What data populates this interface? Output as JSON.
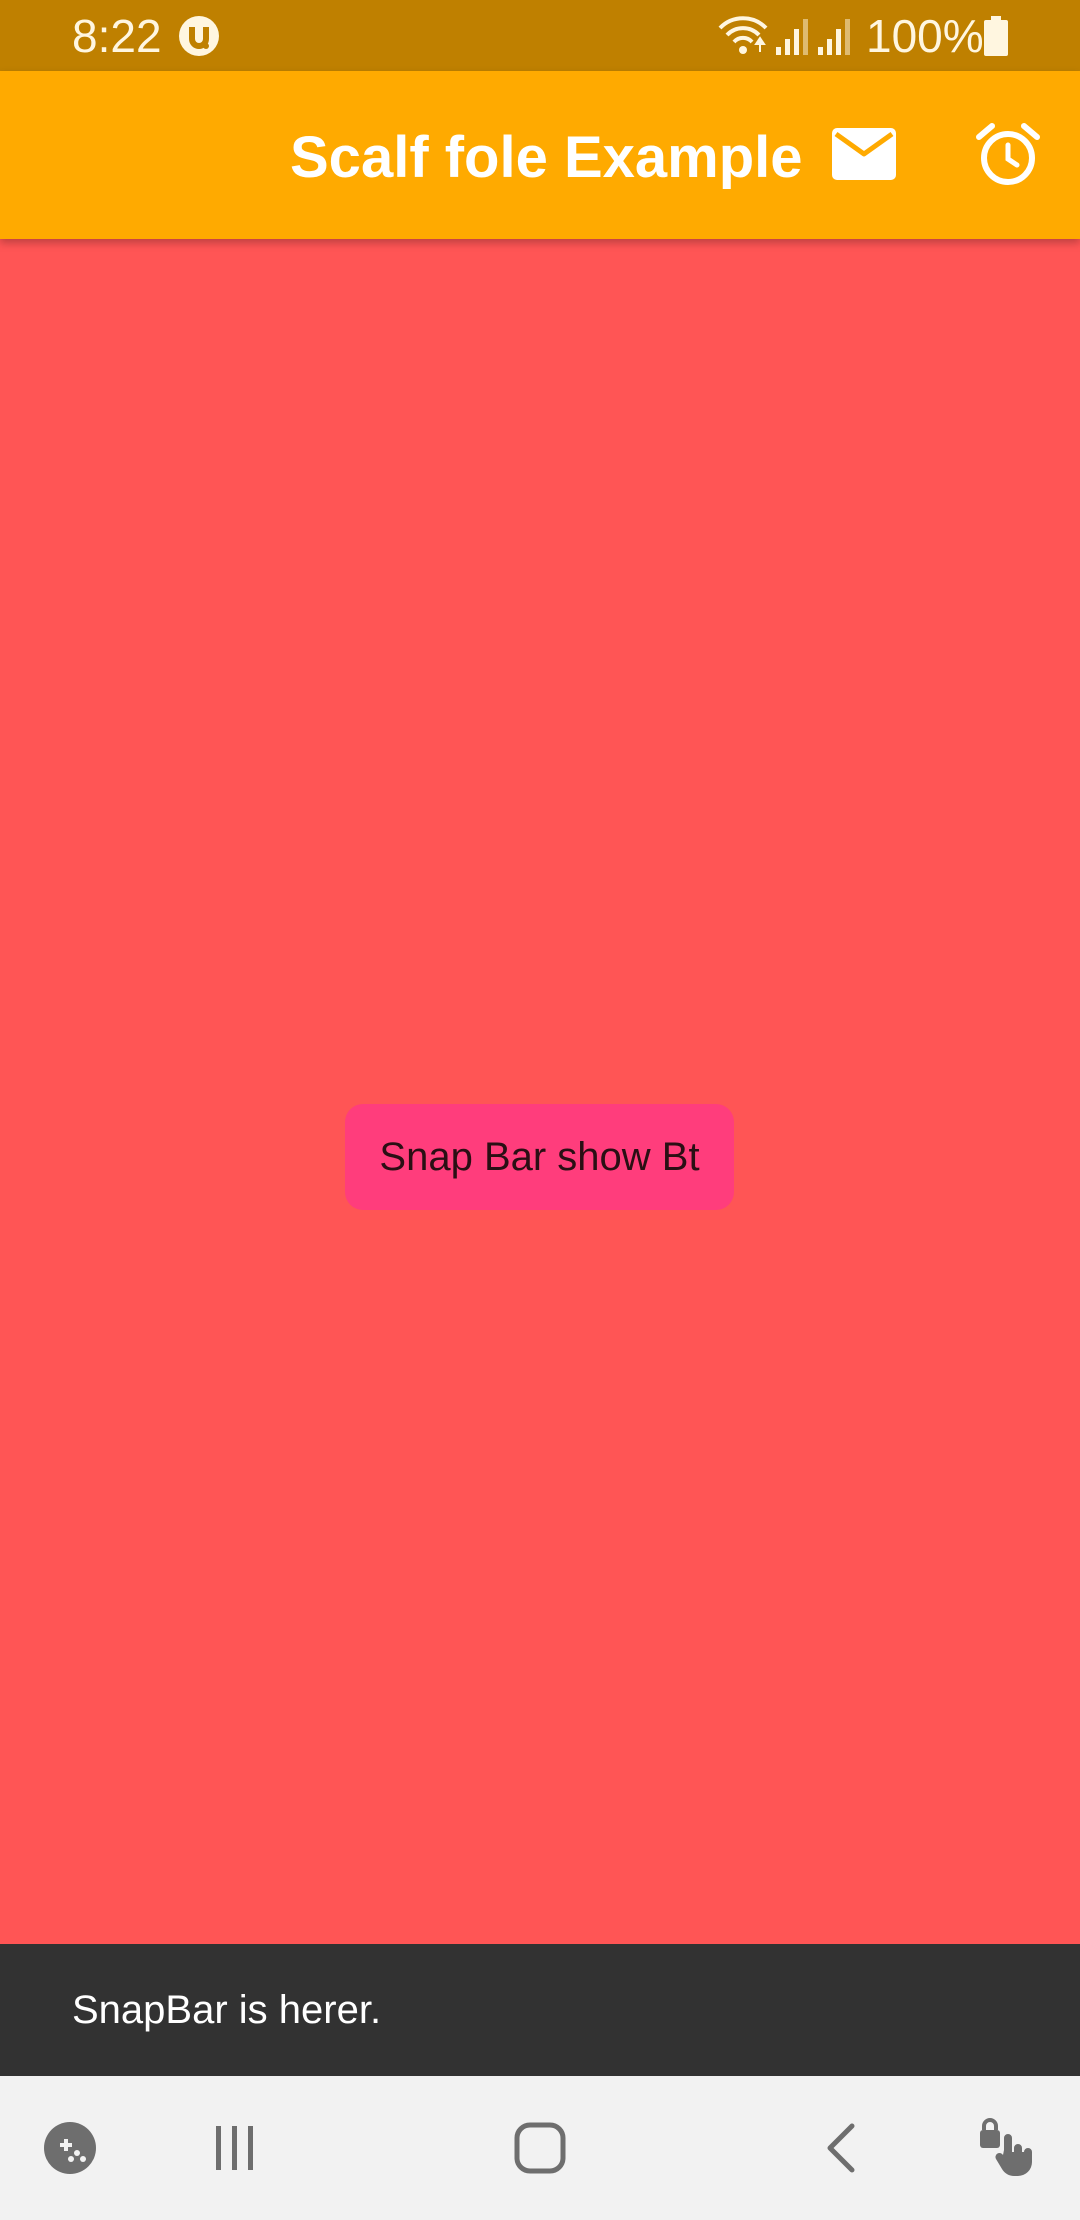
{
  "status_bar": {
    "time": "8:22",
    "battery_text": "100%",
    "icons": [
      "utorrent-icon",
      "wifi-icon",
      "signal-icon",
      "signal-icon",
      "battery-icon"
    ],
    "color": "#BF8000"
  },
  "app_bar": {
    "title": "Scalf fole Example",
    "actions": [
      "mail-icon",
      "alarm-icon"
    ],
    "color": "#FFAA00"
  },
  "main": {
    "background": "#FF5555",
    "button_label": "Snap Bar show Bt",
    "button_color": "#FF3D7C"
  },
  "snackbar": {
    "text": "SnapBar is herer.",
    "background": "#323232"
  },
  "nav_bar": {
    "items": [
      "game-launcher-icon",
      "recents-icon",
      "home-icon",
      "back-icon",
      "touch-lock-icon"
    ]
  }
}
